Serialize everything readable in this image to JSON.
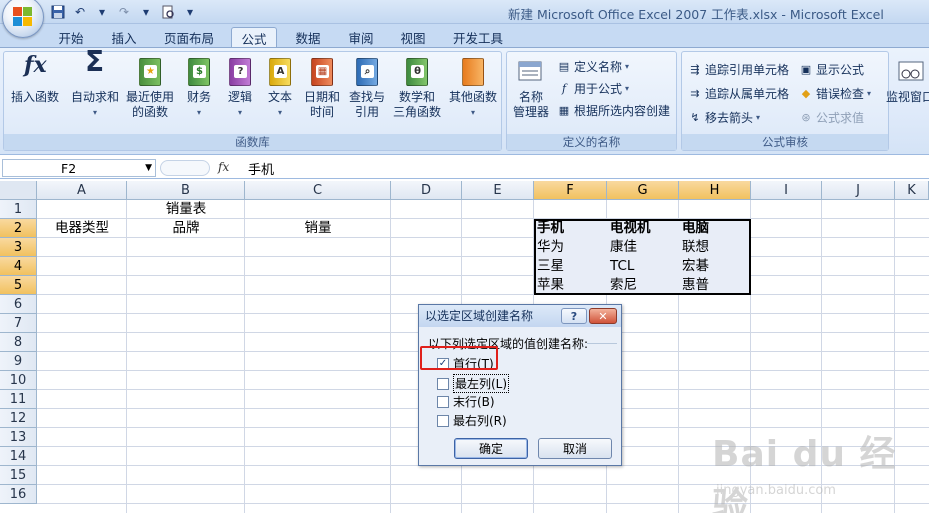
{
  "app": {
    "window_title": "新建 Microsoft Office Excel 2007 工作表.xlsx - Microsoft Excel"
  },
  "tabs": [
    "开始",
    "插入",
    "页面布局",
    "公式",
    "数据",
    "审阅",
    "视图",
    "开发工具"
  ],
  "active_tab": "公式",
  "ribbon": {
    "function_library": {
      "label": "函数库",
      "insert_function": "插入函数",
      "autosum": "自动求和",
      "recent_line1": "最近使用",
      "recent_line2": "的函数",
      "financial": "财务",
      "logical": "逻辑",
      "text": "文本",
      "datetime_line1": "日期和",
      "datetime_line2": "时间",
      "lookup_line1": "查找与",
      "lookup_line2": "引用",
      "math_line1": "数学和",
      "math_line2": "三角函数",
      "more": "其他函数"
    },
    "defined_names": {
      "label": "定义的名称",
      "name_manager_line1": "名称",
      "name_manager_line2": "管理器",
      "define_name": "定义名称",
      "use_in_formula": "用于公式",
      "create_from_selection": "根据所选内容创建"
    },
    "formula_auditing": {
      "label": "公式审核",
      "trace_precedents": "追踪引用单元格",
      "trace_dependents": "追踪从属单元格",
      "remove_arrows": "移去箭头",
      "show_formulas": "显示公式",
      "error_checking": "错误检查",
      "evaluate_formula": "公式求值"
    },
    "watch_window": "监视窗口"
  },
  "formula_bar": {
    "name_box": "F2",
    "fx": "fx",
    "content": "手机"
  },
  "sheet": {
    "columns": [
      "A",
      "B",
      "C",
      "D",
      "E",
      "F",
      "G",
      "H",
      "I",
      "J",
      "K"
    ],
    "rows": [
      "1",
      "2",
      "3",
      "4",
      "5",
      "6",
      "7",
      "8",
      "9",
      "10",
      "11",
      "12",
      "13",
      "14",
      "15",
      "16"
    ],
    "cells": {
      "B1": "销量表",
      "A2": "电器类型",
      "B2": "品牌",
      "C2": "销量",
      "F2": "手机",
      "G2": "电视机",
      "H2": "电脑",
      "F3": "华为",
      "G3": "康佳",
      "H3": "联想",
      "F4": "三星",
      "G4": "TCL",
      "H4": "宏碁",
      "F5": "苹果",
      "G5": "索尼",
      "H5": "惠普"
    }
  },
  "dialog": {
    "title": "以选定区域创建名称",
    "help": "?",
    "close": "✕",
    "prompt": "以下列选定区域的值创建名称:",
    "options": [
      {
        "label": "首行(T)",
        "checked": true
      },
      {
        "label": "最左列(L)",
        "checked": false
      },
      {
        "label": "末行(B)",
        "checked": false
      },
      {
        "label": "最右列(R)",
        "checked": false
      }
    ],
    "ok": "确定",
    "cancel": "取消"
  },
  "watermark": {
    "main": "Bai du 经验",
    "sub": "jingyan.baidu.com"
  }
}
